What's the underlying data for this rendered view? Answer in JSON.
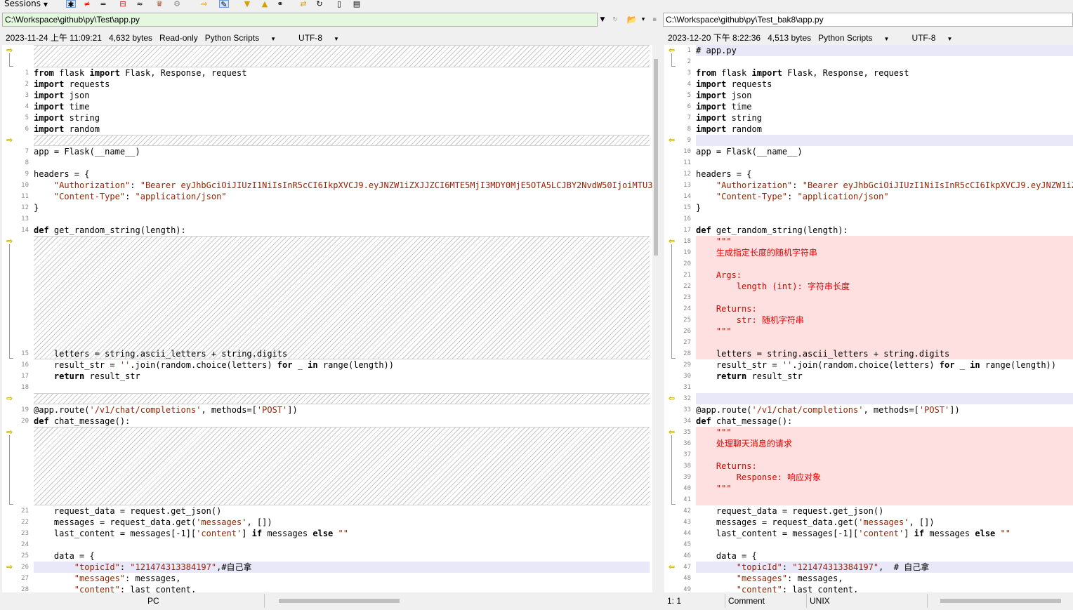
{
  "toolbar": {
    "sessions_label": "Sessions"
  },
  "left": {
    "path": "C:\\Workspace\\github\\py\\Test\\app.py",
    "date": "2023-11-24 上午 11:09:21",
    "size": "4,632 bytes",
    "readonly": "Read-only",
    "format": "Python Scripts",
    "encoding": "UTF-8",
    "lines": [
      {
        "n": "1",
        "t": "from flask import Flask, Response, request"
      },
      {
        "n": "2",
        "t": "import requests"
      },
      {
        "n": "3",
        "t": "import json"
      },
      {
        "n": "4",
        "t": "import time"
      },
      {
        "n": "5",
        "t": "import string"
      },
      {
        "n": "6",
        "t": "import random"
      },
      {
        "n": "7",
        "t": "app = Flask(__name__)"
      },
      {
        "n": "8",
        "t": ""
      },
      {
        "n": "9",
        "t": "headers = {"
      },
      {
        "n": "10",
        "t": "    \"Authorization\": \"Bearer eyJhbGciOiJIUzI1NiIsInR5cCI6IkpXVCJ9.eyJNZW1iZXJJZCI6MTE5MjI3MDY0MjE5OTA5LCJBY2NvdW50IjoiMTU3OTE"
      },
      {
        "n": "11",
        "t": "    \"Content-Type\": \"application/json\""
      },
      {
        "n": "12",
        "t": "}"
      },
      {
        "n": "13",
        "t": ""
      },
      {
        "n": "14",
        "t": "def get_random_string(length):"
      },
      {
        "n": "15",
        "t": "    letters = string.ascii_letters + string.digits"
      },
      {
        "n": "16",
        "t": "    result_str = ''.join(random.choice(letters) for _ in range(length))"
      },
      {
        "n": "17",
        "t": "    return result_str"
      },
      {
        "n": "18",
        "t": ""
      },
      {
        "n": "19",
        "t": "@app.route('/v1/chat/completions', methods=['POST'])"
      },
      {
        "n": "20",
        "t": "def chat_message():"
      },
      {
        "n": "21",
        "t": "    request_data = request.get_json()"
      },
      {
        "n": "22",
        "t": "    messages = request_data.get('messages', [])"
      },
      {
        "n": "23",
        "t": "    last_content = messages[-1]['content'] if messages else \"\""
      },
      {
        "n": "24",
        "t": ""
      },
      {
        "n": "25",
        "t": "    data = {"
      },
      {
        "n": "26",
        "t": "        \"topicId\": \"121474313384197\",#自己拿"
      },
      {
        "n": "27",
        "t": "        \"messages\": messages,"
      },
      {
        "n": "28",
        "t": "        \"content\": last_content,"
      }
    ]
  },
  "right": {
    "path": "C:\\Workspace\\github\\py\\Test_bak8\\app.py",
    "date": "2023-12-20 下午 8:22:36",
    "size": "4,513 bytes",
    "format": "Python Scripts",
    "encoding": "UTF-8",
    "lines": [
      {
        "n": "1",
        "t": "# app.py"
      },
      {
        "n": "2",
        "t": ""
      },
      {
        "n": "3",
        "t": "from flask import Flask, Response, request"
      },
      {
        "n": "4",
        "t": "import requests"
      },
      {
        "n": "5",
        "t": "import json"
      },
      {
        "n": "6",
        "t": "import time"
      },
      {
        "n": "7",
        "t": "import string"
      },
      {
        "n": "8",
        "t": "import random"
      },
      {
        "n": "9",
        "t": ""
      },
      {
        "n": "10",
        "t": "app = Flask(__name__)"
      },
      {
        "n": "11",
        "t": ""
      },
      {
        "n": "12",
        "t": "headers = {"
      },
      {
        "n": "13",
        "t": "    \"Authorization\": \"Bearer eyJhbGciOiJIUzI1NiIsInR5cCI6IkpXVCJ9.eyJNZW1iZXJ"
      },
      {
        "n": "14",
        "t": "    \"Content-Type\": \"application/json\""
      },
      {
        "n": "15",
        "t": "}"
      },
      {
        "n": "16",
        "t": ""
      },
      {
        "n": "17",
        "t": "def get_random_string(length):"
      },
      {
        "n": "18",
        "t": "    \"\"\""
      },
      {
        "n": "19",
        "t": "    生成指定长度的随机字符串"
      },
      {
        "n": "20",
        "t": ""
      },
      {
        "n": "21",
        "t": "    Args:"
      },
      {
        "n": "22",
        "t": "        length (int): 字符串长度"
      },
      {
        "n": "23",
        "t": ""
      },
      {
        "n": "24",
        "t": "    Returns:"
      },
      {
        "n": "25",
        "t": "        str: 随机字符串"
      },
      {
        "n": "26",
        "t": "    \"\"\""
      },
      {
        "n": "27",
        "t": ""
      },
      {
        "n": "28",
        "t": "    letters = string.ascii_letters + string.digits"
      },
      {
        "n": "29",
        "t": "    result_str = ''.join(random.choice(letters) for _ in range(length))"
      },
      {
        "n": "30",
        "t": "    return result_str"
      },
      {
        "n": "31",
        "t": ""
      },
      {
        "n": "32",
        "t": ""
      },
      {
        "n": "33",
        "t": "@app.route('/v1/chat/completions', methods=['POST'])"
      },
      {
        "n": "34",
        "t": "def chat_message():"
      },
      {
        "n": "35",
        "t": "    \"\"\""
      },
      {
        "n": "36",
        "t": "    处理聊天消息的请求"
      },
      {
        "n": "37",
        "t": ""
      },
      {
        "n": "38",
        "t": "    Returns:"
      },
      {
        "n": "39",
        "t": "        Response: 响应对象"
      },
      {
        "n": "40",
        "t": "    \"\"\""
      },
      {
        "n": "41",
        "t": ""
      },
      {
        "n": "42",
        "t": "    request_data = request.get_json()"
      },
      {
        "n": "43",
        "t": "    messages = request_data.get('messages', [])"
      },
      {
        "n": "44",
        "t": "    last_content = messages[-1]['content'] if messages else \"\""
      },
      {
        "n": "45",
        "t": ""
      },
      {
        "n": "46",
        "t": "    data = {"
      },
      {
        "n": "47",
        "t": "        \"topicId\": \"121474313384197\",  # 自己拿"
      },
      {
        "n": "48",
        "t": "        \"messages\": messages,"
      },
      {
        "n": "49",
        "t": "        \"content\": last_content,"
      }
    ]
  },
  "status": {
    "left_eol": "PC",
    "right_pos": "1: 1",
    "right_mode": "Comment",
    "right_eol": "UNIX"
  }
}
